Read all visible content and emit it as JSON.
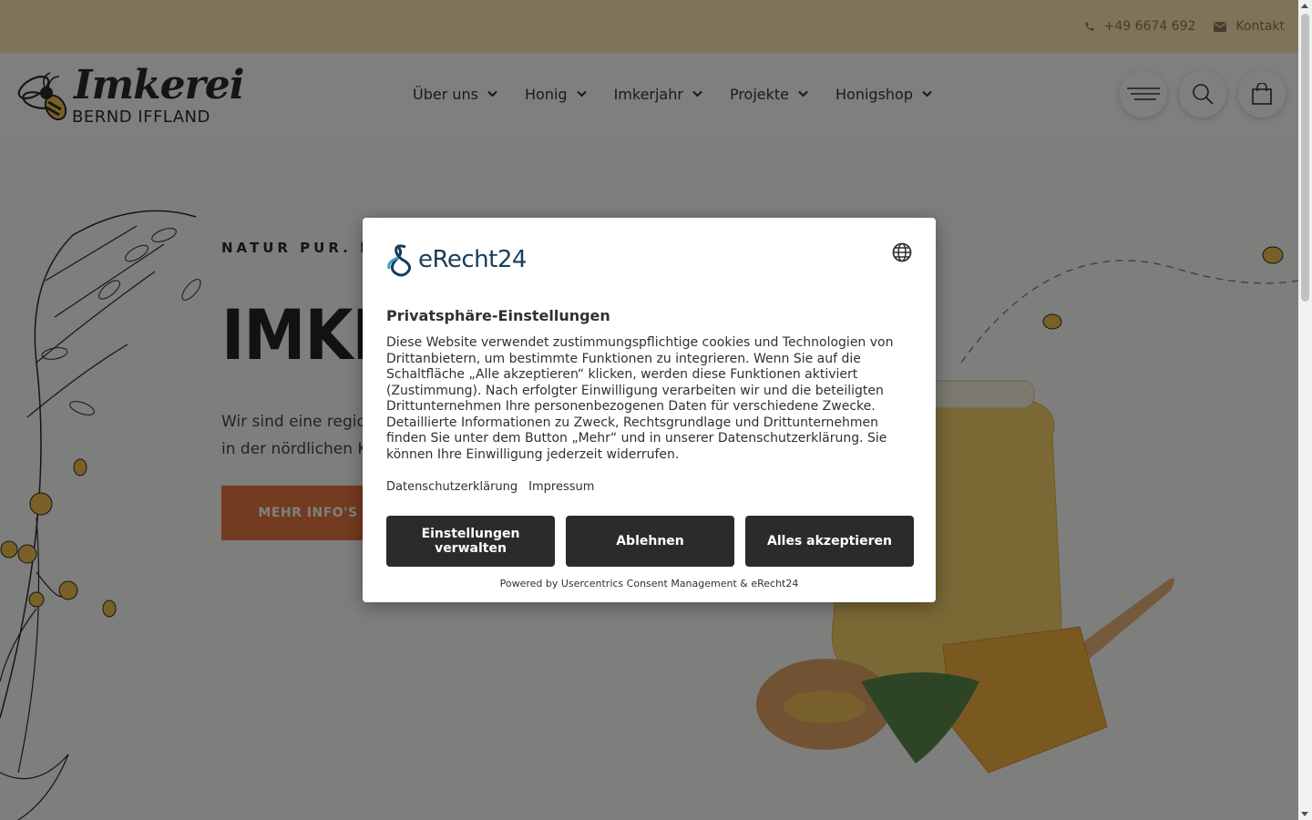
{
  "topbar": {
    "phone": "+49 6674 692",
    "contact": "Kontakt"
  },
  "logo": {
    "script": "Imkerei",
    "subtitle": "BERND IFFLAND"
  },
  "nav": {
    "items": [
      "Über uns",
      "Honig",
      "Imkerjahr",
      "Projekte",
      "Honigshop"
    ]
  },
  "hero": {
    "eyebrow": "NATUR PUR. HO",
    "headline": "IMKE",
    "lead_line1": "Wir sind eine regio",
    "lead_line2": "in der nördlichen K",
    "cta": "MEHR INFO'S"
  },
  "consent": {
    "brand": "eRecht24",
    "title": "Privatsphäre-Einstellungen",
    "body": "Diese Website verwendet zustimmungspflichtige cookies und Technologien von Drittanbietern, um bestimmte Funktionen zu integrieren. Wenn Sie auf die Schaltfläche „Alle akzeptieren“ klicken, werden diese Funktionen aktiviert (Zustimmung). Nach erfolgter Einwilligung verarbeiten wir und die beteiligten Drittunternehmen Ihre personenbezogenen Daten für verschiedene Zwecke. Detaillierte Informationen zu Zweck, Rechtsgrundlage und Drittunternehmen finden Sie unter dem Button „Mehr“ und in unserer Datenschutzerklärung. Sie können Ihre Einwilligung jederzeit widerrufen.",
    "link_privacy": "Datenschutzerklärung",
    "link_imprint": "Impressum",
    "btn_settings": "Einstellungen verwalten",
    "btn_decline": "Ablehnen",
    "btn_accept": "Alles akzeptieren",
    "powered": "Powered by Usercentrics Consent Management & eRecht24"
  },
  "colors": {
    "topbar": "#fde8b4",
    "cta": "#e7773f",
    "modal_button": "#2b2b2b",
    "brand": "#1a3d57"
  }
}
